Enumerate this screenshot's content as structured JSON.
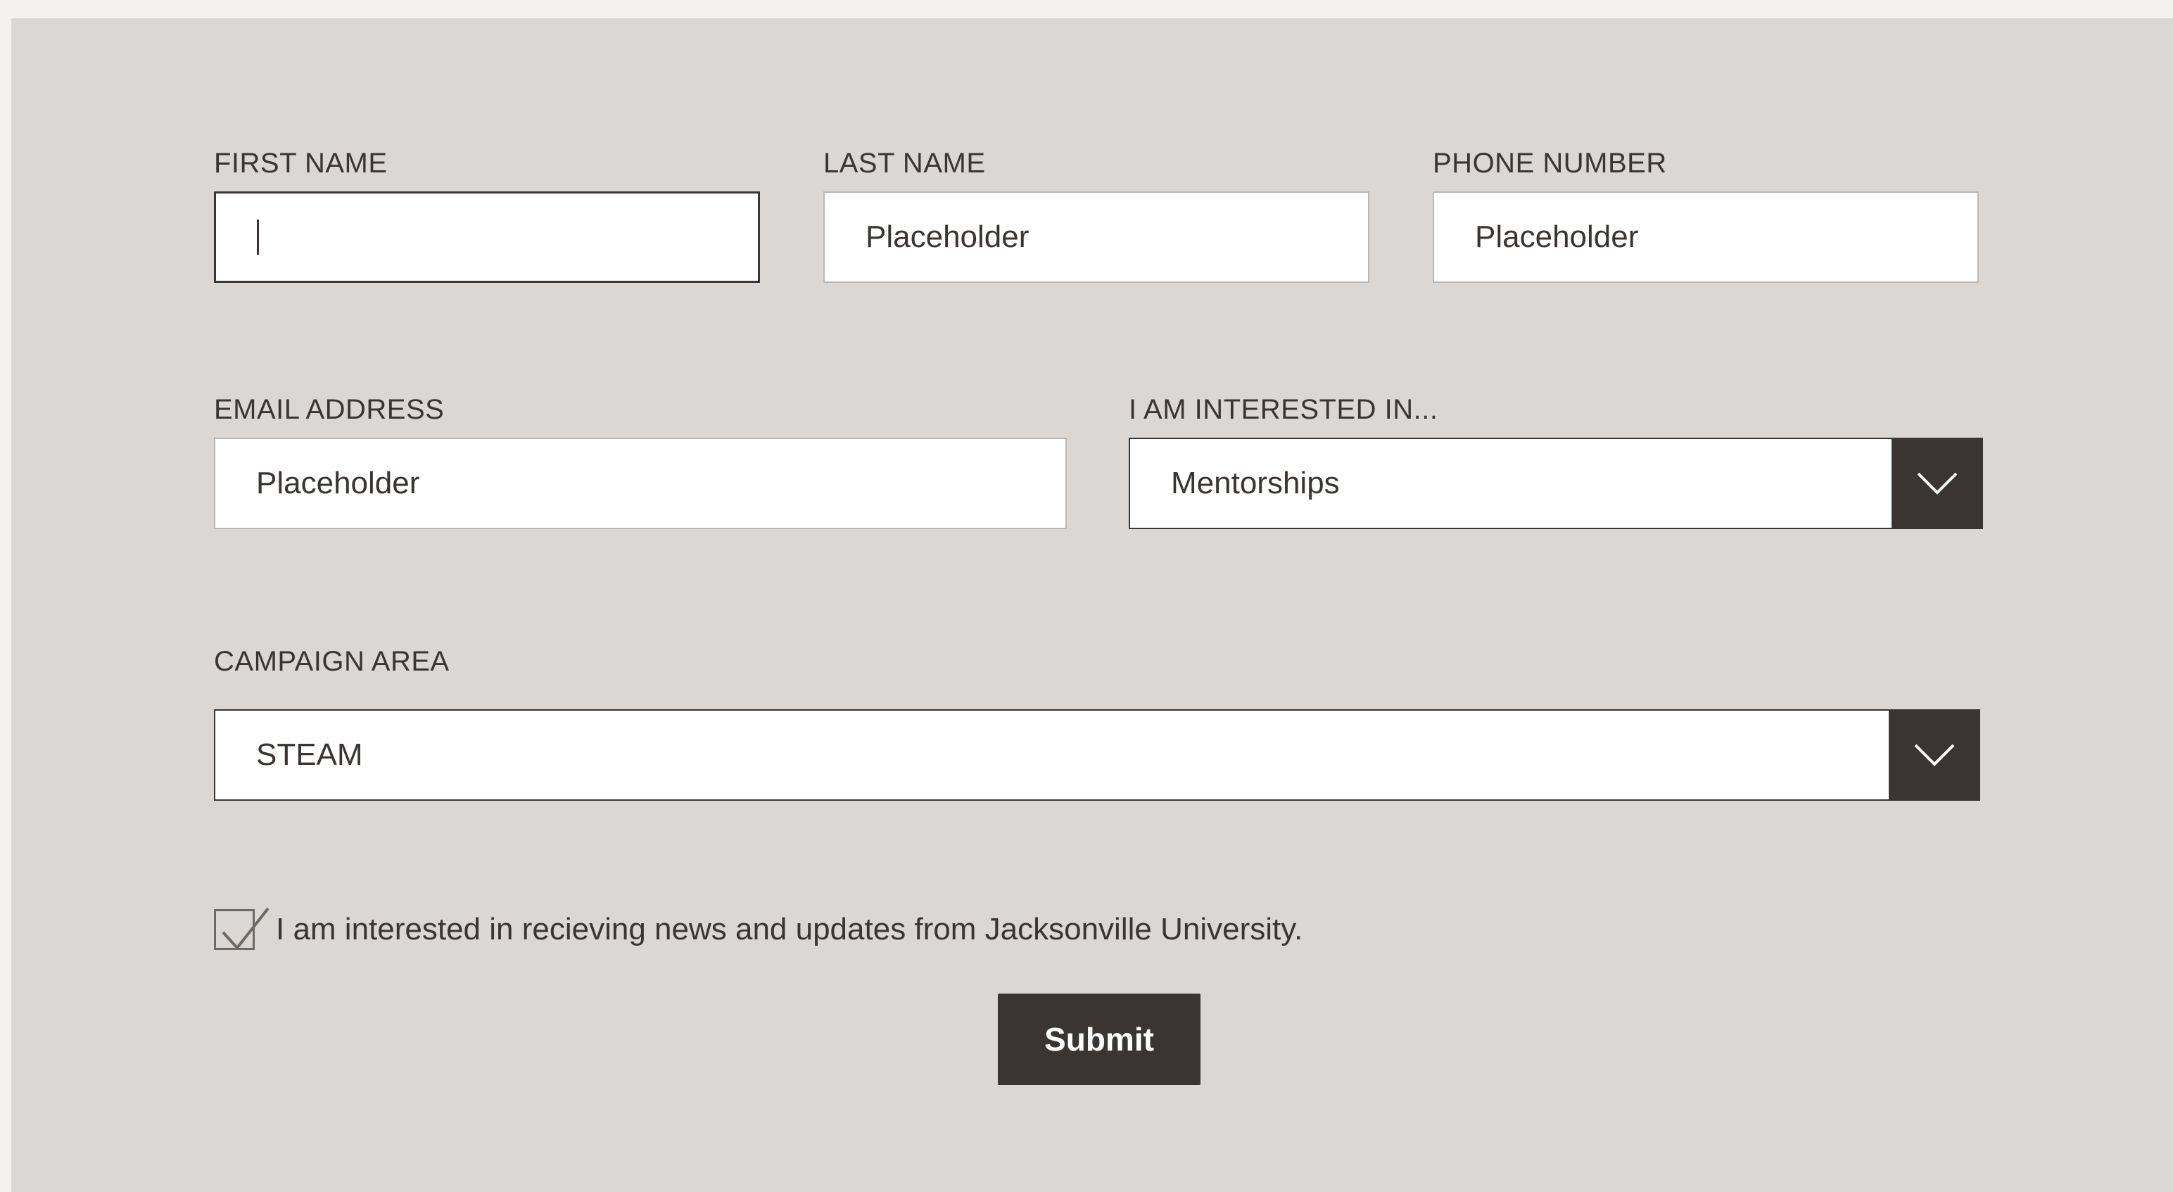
{
  "form": {
    "first_name": {
      "label": "FIRST NAME",
      "value": ""
    },
    "last_name": {
      "label": "LAST NAME",
      "value": "Placeholder"
    },
    "phone": {
      "label": "PHONE NUMBER",
      "value": "Placeholder"
    },
    "email": {
      "label": "EMAIL ADDRESS",
      "value": "Placeholder"
    },
    "interest": {
      "label": "I AM INTERESTED IN...",
      "selected": "Mentorships"
    },
    "campaign": {
      "label": "CAMPAIGN AREA",
      "selected": "STEAM"
    },
    "newsletter": {
      "label": "I am interested in recieving news and updates from Jacksonville University.",
      "checked": true
    },
    "submit_label": "Submit"
  },
  "colors": {
    "background": "#dbd7d4",
    "dark": "#3a3532",
    "field_bg": "#ffffff"
  },
  "icons": {
    "dropdown": "chevron-down-icon",
    "checkbox": "checkmark-icon"
  }
}
